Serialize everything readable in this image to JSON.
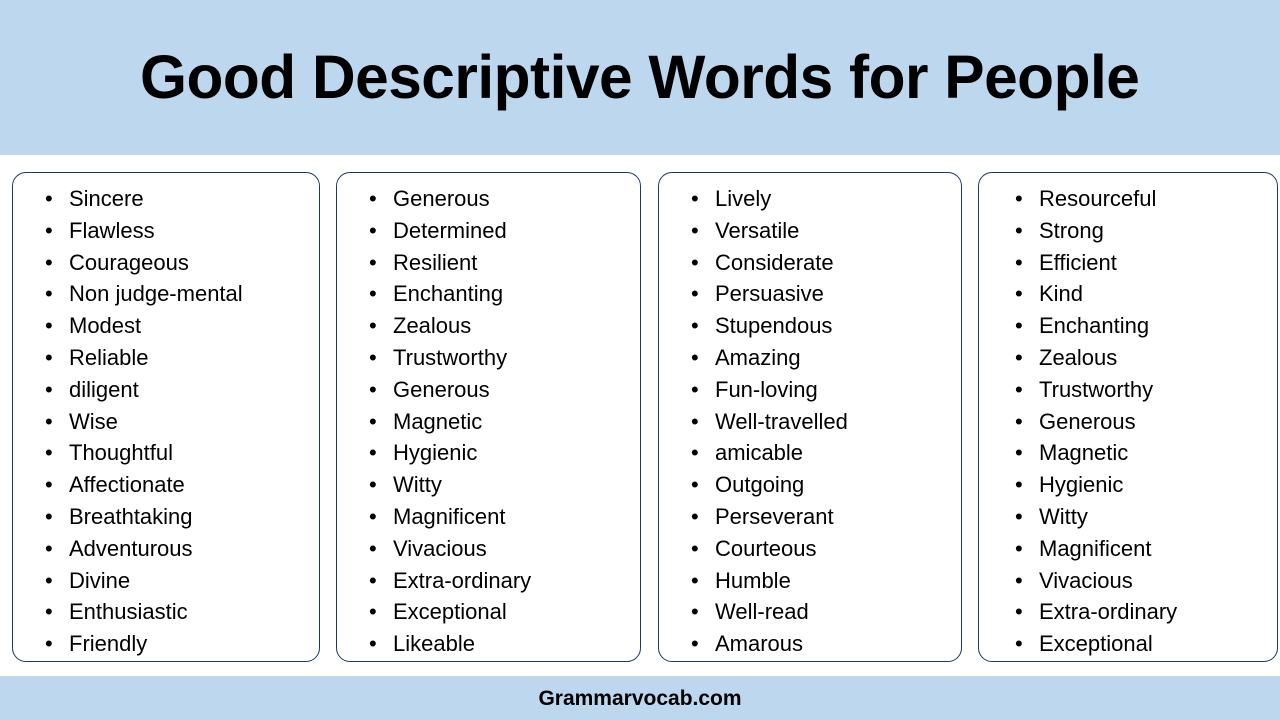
{
  "header": {
    "title": "Good Descriptive Words for People",
    "background_color": "#bdd7ee"
  },
  "footer": {
    "text": "Grammarvocab.com",
    "background_color": "#bdd7ee"
  },
  "card_style": {
    "border_color": "#1f3864",
    "background_color": "#ffffff",
    "bullet_glyph": "•"
  },
  "columns": [
    {
      "id": "column-1",
      "items": [
        "Sincere",
        "Flawless",
        "Courageous",
        "Non judge-mental",
        "Modest",
        "Reliable",
        "diligent",
        "Wise",
        "Thoughtful",
        "Affectionate",
        "Breathtaking",
        "Adventurous",
        "Divine",
        "Enthusiastic",
        "Friendly"
      ]
    },
    {
      "id": "column-2",
      "items": [
        "Generous",
        "Determined",
        "Resilient",
        "Enchanting",
        "Zealous",
        "Trustworthy",
        "Generous",
        "Magnetic",
        "Hygienic",
        "Witty",
        "Magnificent",
        "Vivacious",
        "Extra-ordinary",
        "Exceptional",
        "Likeable"
      ]
    },
    {
      "id": "column-3",
      "items": [
        "Lively",
        "Versatile",
        "Considerate",
        "Persuasive",
        "Stupendous",
        "Amazing",
        "Fun-loving",
        "Well-travelled",
        "amicable",
        "Outgoing",
        "Perseverant",
        "Courteous",
        "Humble",
        "Well-read",
        "Amarous"
      ]
    },
    {
      "id": "column-4",
      "items": [
        "Resourceful",
        "Strong",
        "Efficient",
        "Kind",
        "Enchanting",
        "Zealous",
        "Trustworthy",
        "Generous",
        "Magnetic",
        "Hygienic",
        "Witty",
        "Magnificent",
        "Vivacious",
        "Extra-ordinary",
        "Exceptional"
      ]
    }
  ]
}
